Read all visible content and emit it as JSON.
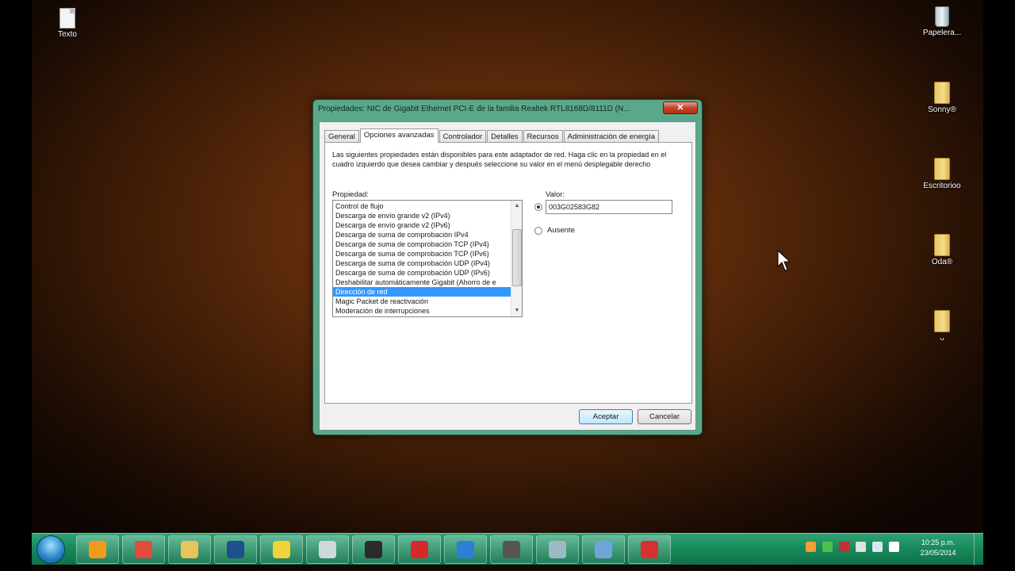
{
  "desktop": {
    "icons": [
      {
        "label": "Texto",
        "icon": "text-document-icon"
      },
      {
        "label": "Papelera...",
        "icon": "recycle-bin-icon"
      },
      {
        "label": "Sonny®",
        "icon": "folder-icon"
      },
      {
        "label": "Escritorioo",
        "icon": "folder-icon"
      },
      {
        "label": "Oda®",
        "icon": "folder-icon"
      },
      {
        "label": "ᴗ",
        "icon": "folder-icon"
      }
    ]
  },
  "dialog": {
    "title": "Propiedades: NIC de Gigabit Ethernet PCI-E de la familia Realtek RTL8168D/8111D (N...",
    "close_label": "✕",
    "tabs": [
      "General",
      "Opciones avanzadas",
      "Controlador",
      "Detalles",
      "Recursos",
      "Administración de energía"
    ],
    "active_tab": "Opciones avanzadas",
    "description": "Las siguientes propiedades están disponibles para este adaptador de red. Haga clic en la propiedad en el cuadro izquierdo que desea cambiar y después seleccione su valor en el menú desplegable derecho",
    "property_label": "Propiedad:",
    "value_label": "Valor:",
    "properties": [
      "Control de flujo",
      "Descarga de envío grande v2 (IPv4)",
      "Descarga de envío grande v2 (IPv6)",
      "Descarga de suma de comprobación IPv4",
      "Descarga de suma de comprobación TCP (IPv4)",
      "Descarga de suma de comprobación TCP (IPv6)",
      "Descarga de suma de comprobación UDP (IPv4)",
      "Descarga de suma de comprobación UDP (IPv6)",
      "Deshabilitar automáticamente Gigabit (Ahorro de e",
      "Dirección de red",
      "Magic Packet de reactivación",
      "Moderación de interrupciones"
    ],
    "selected_property": "Dirección de red",
    "value": "003G02583G82",
    "absent_label": "Ausente",
    "ok_label": "Aceptar",
    "cancel_label": "Cancelar"
  },
  "taskbar": {
    "apps": [
      {
        "name": "media-player-icon",
        "color": "#f39a1d"
      },
      {
        "name": "chrome-icon",
        "color": "#e24b3b"
      },
      {
        "name": "file-explorer-icon",
        "color": "#e8c45a"
      },
      {
        "name": "photoshop-icon",
        "color": "#1f4f8e"
      },
      {
        "name": "bittorrent-icon",
        "color": "#f2d23a"
      },
      {
        "name": "app-icon",
        "color": "#cfd8dc"
      },
      {
        "name": "game-icon",
        "color": "#2b2b2b"
      },
      {
        "name": "car-game-icon",
        "color": "#d62a2a"
      },
      {
        "name": "crescent-app-icon",
        "color": "#2d7fd6"
      },
      {
        "name": "network-tool-icon",
        "color": "#555555"
      },
      {
        "name": "device-icon",
        "color": "#9fb8c8"
      },
      {
        "name": "network-connections-icon",
        "color": "#6fa4d8"
      },
      {
        "name": "red-app-icon",
        "color": "#d82f2f"
      }
    ],
    "tray": [
      "notification-icon",
      "security-icon",
      "network-alert-icon",
      "flag-icon",
      "display-icon",
      "volume-icon"
    ],
    "clock_time": "10:25 p.m.",
    "clock_date": "23/05/2014"
  }
}
